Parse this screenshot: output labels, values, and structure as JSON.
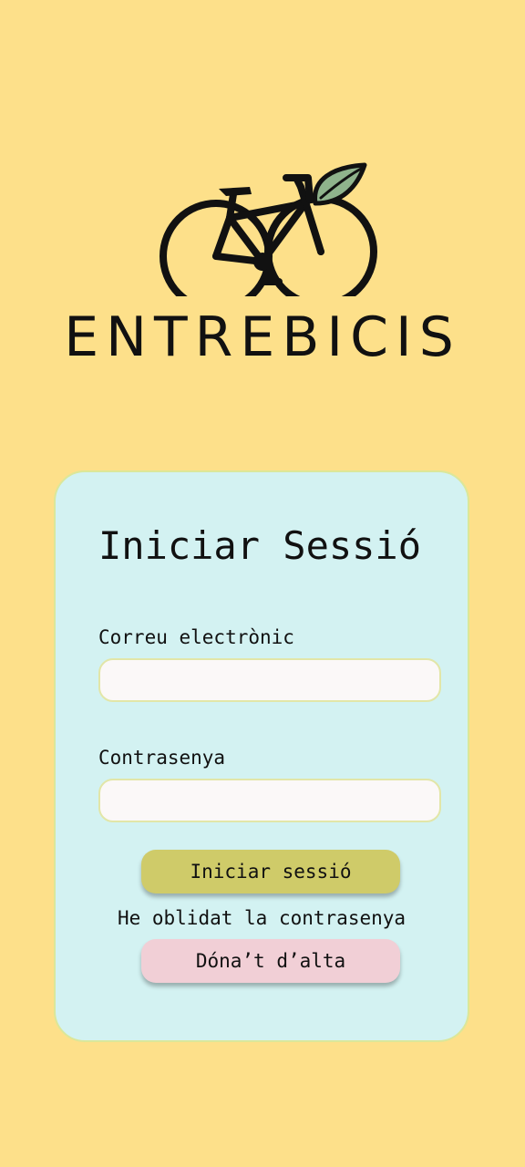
{
  "app": {
    "brand_name": "ENTREBICIS"
  },
  "login": {
    "title": "Iniciar Sessió",
    "email_label": "Correu electrònic",
    "email_value": "",
    "email_placeholder": "",
    "password_label": "Contrasenya",
    "password_value": "",
    "password_placeholder": "",
    "submit_label": "Iniciar sessió",
    "forgot_password_label": "He oblidat la contrasenya",
    "signup_label": "Dóna’t d’alta"
  },
  "icons": {
    "logo": "bicycle-with-leaf-icon"
  },
  "colors": {
    "background": "#fde08a",
    "card": "#d3f2f2",
    "card_border": "#dbe79a",
    "login_button": "#cfcb69",
    "signup_button": "#f1cfd6",
    "leaf": "#8fb38c"
  }
}
